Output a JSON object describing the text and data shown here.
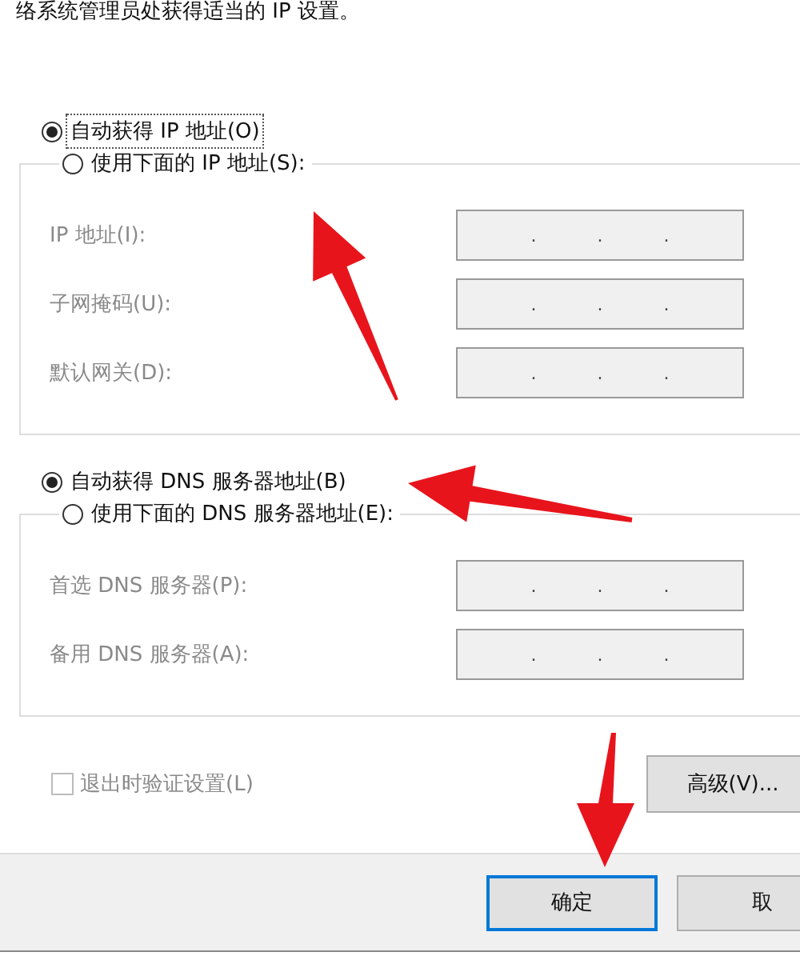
{
  "intro_text": "络系统管理员处获得适当的 IP 设置。",
  "ip_mode": [
    {
      "label": "自动获得 IP 地址(O)",
      "selected": true
    },
    {
      "label": "使用下面的 IP 地址(S):",
      "selected": false
    }
  ],
  "ip_fields": [
    {
      "label": "IP 地址(I):",
      "disabled": true,
      "dots": [
        ".",
        ".",
        "."
      ]
    },
    {
      "label": "子网掩码(U):",
      "disabled": true,
      "dots": [
        ".",
        ".",
        "."
      ]
    },
    {
      "label": "默认网关(D):",
      "disabled": true,
      "dots": [
        ".",
        ".",
        "."
      ]
    }
  ],
  "dns_mode": [
    {
      "label": "自动获得 DNS 服务器地址(B)",
      "selected": true
    },
    {
      "label": "使用下面的 DNS 服务器地址(E):",
      "selected": false
    }
  ],
  "dns_fields": [
    {
      "label": "首选 DNS 服务器(P):",
      "disabled": true,
      "dots": [
        ".",
        ".",
        "."
      ]
    },
    {
      "label": "备用 DNS 服务器(A):",
      "disabled": true,
      "dots": [
        ".",
        ".",
        "."
      ]
    }
  ],
  "validate_checkbox": {
    "label": "退出时验证设置(L)",
    "checked": false,
    "disabled": true
  },
  "advanced_button": "高级(V)...",
  "footer_buttons": [
    {
      "label": "确定",
      "default": true
    },
    {
      "label": "取",
      "default": false
    }
  ],
  "annotation_arrows": [
    {
      "kind": "upleft"
    },
    {
      "kind": "left"
    },
    {
      "kind": "down"
    }
  ]
}
